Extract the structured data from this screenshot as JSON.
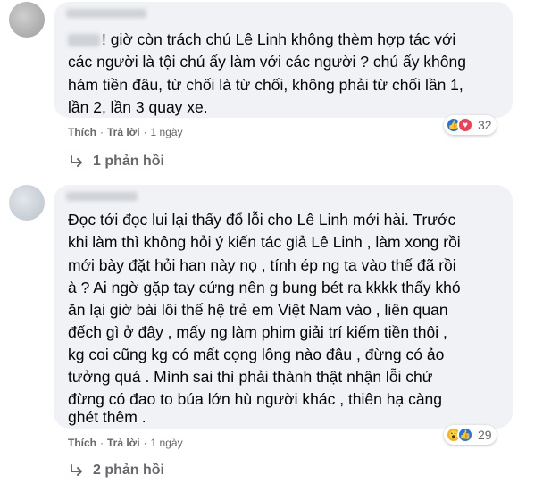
{
  "comments": [
    {
      "text_lines": [
        "! giờ còn trách chú Lê Linh không thèm hợp tác với",
        "các người là tội chú ấy làm với các người ? chú ấy không",
        "hám tiền đâu, từ chối là từ chối, không phải từ chối lần 1,",
        "lần 2, lần 3 quay xe."
      ],
      "like_label": "Thích",
      "reply_label": "Trả lời",
      "time": "1 ngày",
      "reactions": [
        "like-icon",
        "love-icon"
      ],
      "reaction_count": "32",
      "replies_label": "1 phản hồi"
    },
    {
      "text_lines": [
        "Đọc tới đọc lui lại thấy đổ lỗi cho Lê Linh mới hài. Trước",
        "khi làm thì không hỏi ý kiến tác giả Lê Linh , làm xong rồi",
        "mới bày đặt hỏi han này nọ , tính ép ng ta vào thế đã rồi",
        "à ? Ai ngờ gặp tay cứng nên g bung bét ra kkkk thấy khó",
        "ăn lại giờ bài lôi thế hệ trẻ em Việt Nam vào , liên quan",
        "đếch gì ở đây , mấy ng làm phim giải trí kiếm tiền thôi ,",
        "kg coi cũng kg có mất cọng lông nào đâu , đừng có ảo",
        "tưởng quá . Mình sai thì phải thành thật nhận lỗi chứ",
        "đừng có đao to búa lớn hù người khác , thiên hạ càng",
        "ghét thêm ."
      ],
      "like_label": "Thích",
      "reply_label": "Trả lời",
      "time": "1 ngày",
      "reactions": [
        "wow-icon",
        "like-icon"
      ],
      "reaction_count": "29",
      "replies_label": "2 phản hồi"
    }
  ],
  "colors": {
    "bubble": "#f0f2f5",
    "meta_text": "#65676b",
    "like_blue": "#1877f2",
    "love_red": "#f33e58",
    "wow_yellow": "#f7b125"
  }
}
